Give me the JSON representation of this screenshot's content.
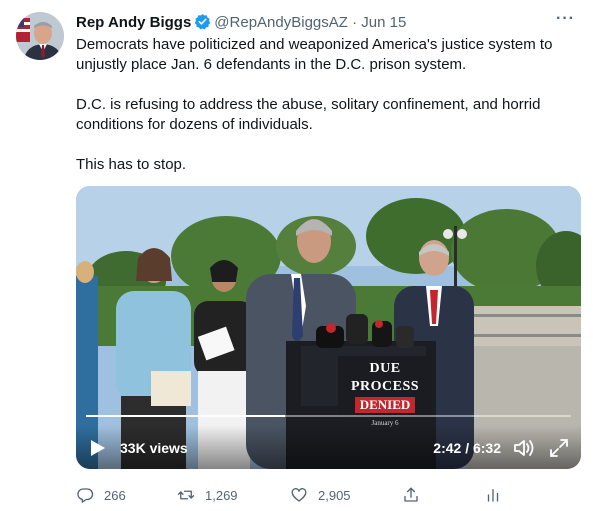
{
  "author": {
    "name": "Rep Andy Biggs",
    "handle": "@RepAndyBiggsAZ",
    "separator": "·",
    "date": "Jun 15"
  },
  "tweet": {
    "paragraphs": [
      "Democrats have politicized and weaponized America's justice system to unjustly place Jan. 6 defendants in the D.C. prison system.",
      "D.C. is refusing to address the abuse, solitary confinement, and horrid conditions for dozens of individuals.",
      "This has to stop."
    ]
  },
  "video": {
    "views": "33K views",
    "timer": "2:42 / 6:32",
    "progress_fraction": 0.41,
    "sign_line1": "DUE PROCESS",
    "sign_line2": "DENIED",
    "sign_small": "January 6"
  },
  "actions": {
    "replies": "266",
    "retweets": "1,269",
    "likes": "2,905"
  },
  "colors": {
    "verified": "#1d9bf0",
    "muted": "#536471",
    "sign_red": "#c0282d"
  }
}
